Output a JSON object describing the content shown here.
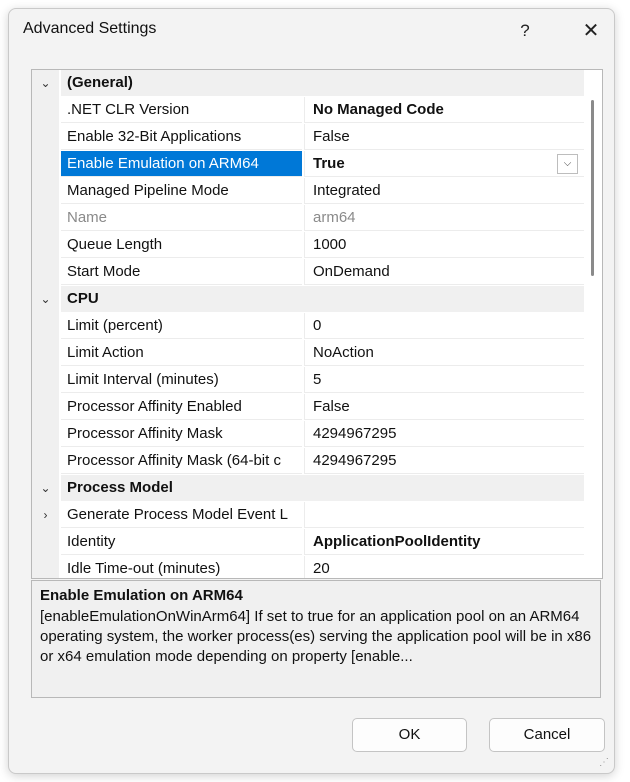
{
  "window": {
    "title": "Advanced Settings",
    "help_label": "?",
    "close_label": "✕"
  },
  "grid": {
    "rows": [
      {
        "kind": "cat",
        "chev": "⌄",
        "name": "(General)"
      },
      {
        "kind": "prop",
        "name": ".NET CLR Version",
        "value": "No Managed Code",
        "bold": true
      },
      {
        "kind": "prop",
        "name": "Enable 32-Bit Applications",
        "value": "False"
      },
      {
        "kind": "prop",
        "name": "Enable Emulation on ARM64",
        "value": "True",
        "bold": true,
        "selected": true
      },
      {
        "kind": "prop",
        "name": "Managed Pipeline Mode",
        "value": "Integrated"
      },
      {
        "kind": "prop",
        "name": "Name",
        "value": "arm64",
        "dim": true
      },
      {
        "kind": "prop",
        "name": "Queue Length",
        "value": "1000"
      },
      {
        "kind": "prop",
        "name": "Start Mode",
        "value": "OnDemand"
      },
      {
        "kind": "cat",
        "chev": "⌄",
        "name": "CPU"
      },
      {
        "kind": "prop",
        "name": "Limit (percent)",
        "value": "0"
      },
      {
        "kind": "prop",
        "name": "Limit Action",
        "value": "NoAction"
      },
      {
        "kind": "prop",
        "name": "Limit Interval (minutes)",
        "value": "5"
      },
      {
        "kind": "prop",
        "name": "Processor Affinity Enabled",
        "value": "False"
      },
      {
        "kind": "prop",
        "name": "Processor Affinity Mask",
        "value": "4294967295"
      },
      {
        "kind": "prop",
        "name": "Processor Affinity Mask (64-bit c",
        "value": "4294967295"
      },
      {
        "kind": "cat",
        "chev": "⌄",
        "name": "Process Model"
      },
      {
        "kind": "prop",
        "chev": "›",
        "name": "Generate Process Model Event L",
        "value": ""
      },
      {
        "kind": "prop",
        "name": "Identity",
        "value": "ApplicationPoolIdentity",
        "bold": true
      },
      {
        "kind": "prop",
        "name": "Idle Time-out (minutes)",
        "value": "20"
      }
    ]
  },
  "description": {
    "title": "Enable Emulation on ARM64",
    "text": "[enableEmulationOnWinArm64] If set to true for an application pool on an ARM64 operating system, the worker process(es) serving the application pool will be in x86 or x64 emulation mode depending on property [enable..."
  },
  "buttons": {
    "ok": "OK",
    "cancel": "Cancel"
  },
  "colors": {
    "selection": "#0078d7",
    "category_bg": "#f0f0f0"
  }
}
